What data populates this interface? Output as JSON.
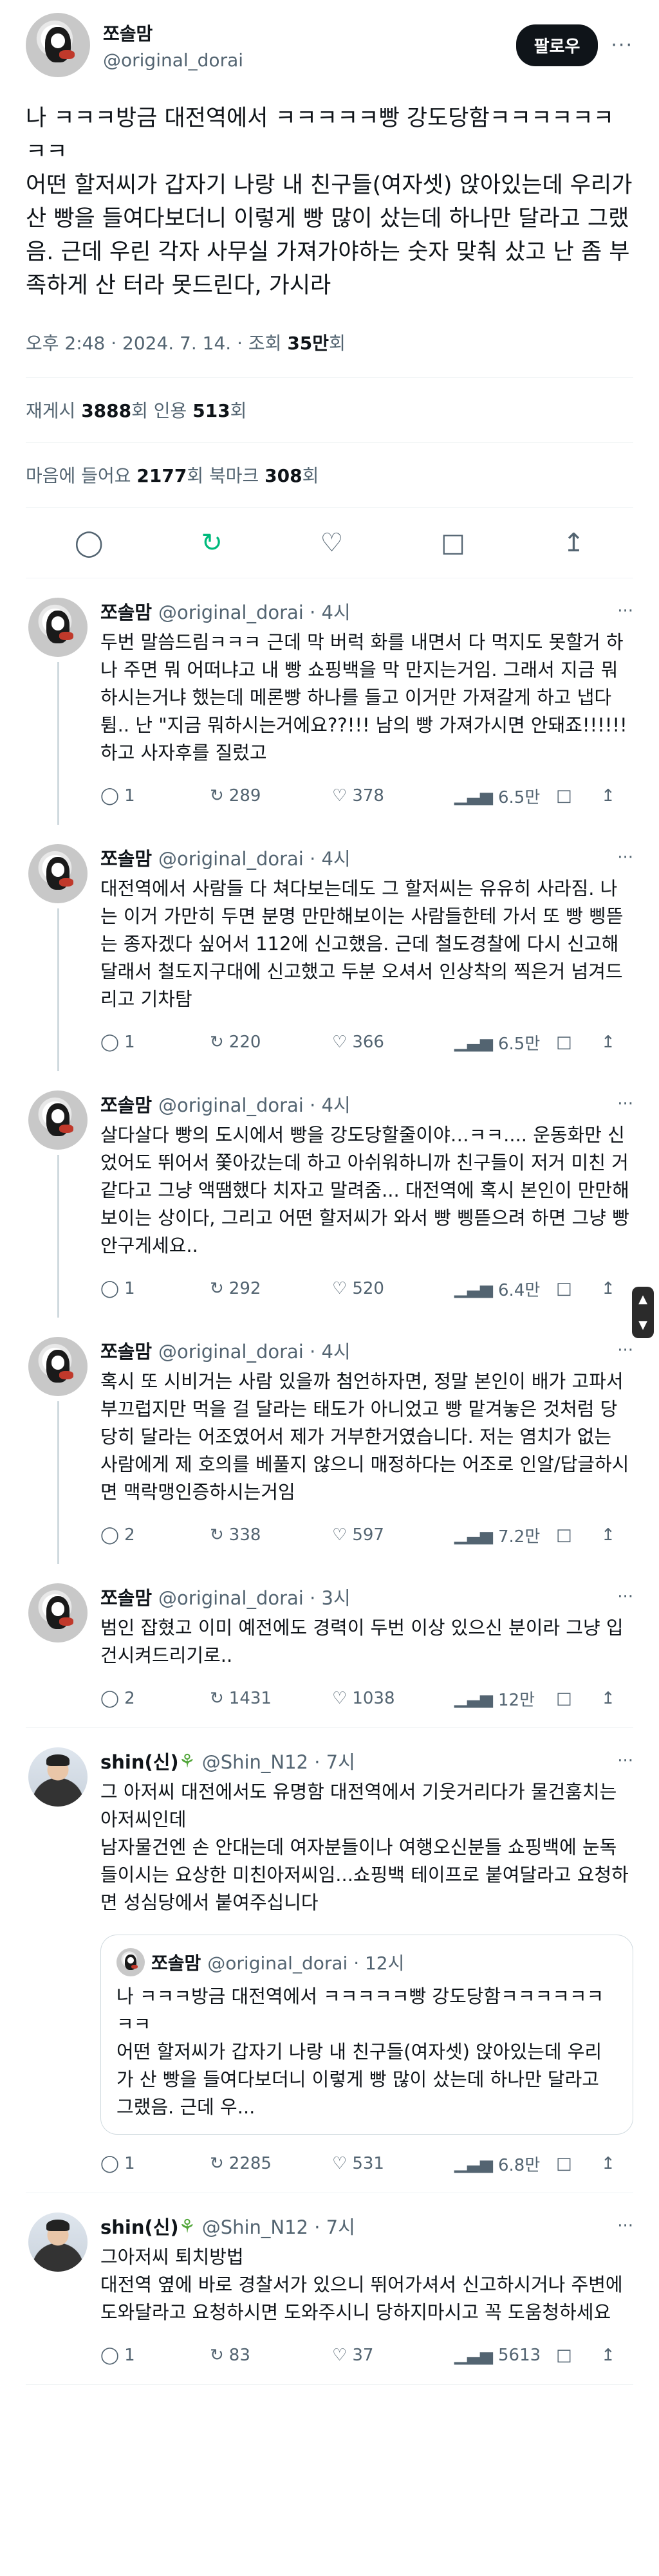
{
  "tweet": {
    "author_name": "쪼솔맘",
    "author_handle": "@original_dorai",
    "follow_label": "팔로우",
    "more": "···",
    "text": "나 ㅋㅋㅋ방금 대전역에서 ㅋㅋㅋㅋㅋ빵 강도당함ㅋㅋㅋㅋㅋㅋㅋㅋ\n어떤 할저씨가 갑자기 나랑 내 친구들(여자셋) 앉아있는데 우리가 산 빵을 들여다보더니 이렇게 빵 많이 샀는데 하나만 달라고 그랬음. 근데 우린 각자 사무실 가져가야하는 숫자 맞춰 샀고 난 좀 부족하게 산 터라 못드린다, 가시라",
    "time": "오후 2:48 · 2024. 7. 14. · 조회 ",
    "views": "35만",
    "views_suffix": "회",
    "retweets_label": "재게시 ",
    "retweets": "3888",
    "retweets_suffix": "회  인용 ",
    "quotes": "513",
    "quotes_suffix": "회",
    "likes_label": "마음에 들어요 ",
    "likes": "2177",
    "likes_suffix": "회  북마크 ",
    "bookmarks": "308",
    "bookmarks_suffix": "회"
  },
  "replies": [
    {
      "name": "쪼솔맘",
      "handle": "@original_dorai · 4시",
      "text": "두번 말씀드림ㅋㅋㅋ 근데 막 버럭 화를 내면서 다 먹지도 못할거 하나 주면 뭐 어떠냐고 내 빵 쇼핑백을 막 만지는거임. 그래서 지금 뭐하시는거냐 했는데 메론빵 하나를 들고 이거만 가져갈게 하고 냅다 튐.. 난 \"지금 뭐하시는거에요??!!! 남의 빵 가져가시면 안돼죠!!!!!!하고 사자후를 질렀고",
      "reply": "1",
      "rt": "289",
      "like": "378",
      "views": "6.5만"
    },
    {
      "name": "쪼솔맘",
      "handle": "@original_dorai · 4시",
      "text": "대전역에서 사람들 다 쳐다보는데도 그 할저씨는 유유히 사라짐. 나는 이거 가만히 두면 분명 만만해보이는 사람들한테 가서 또 빵 삥뜯는 종자겠다 싶어서 112에 신고했음. 근데 철도경찰에 다시 신고해달래서 철도지구대에 신고했고 두분 오셔서 인상착의 찍은거 넘겨드리고 기차탐",
      "reply": "1",
      "rt": "220",
      "like": "366",
      "views": "6.5만"
    },
    {
      "name": "쪼솔맘",
      "handle": "@original_dorai · 4시",
      "text": "살다살다 빵의 도시에서 빵을 강도당할줄이야…ㅋㅋ.... 운동화만 신었어도 뛰어서 쫓아갔는데 하고 아쉬워하니까 친구들이 저거 미친 거 같다고 그냥 액땜했다 치자고 말려줌... 대전역에 혹시 본인이 만만해보이는 상이다, 그리고 어떤 할저씨가 와서 빵 삥뜯으려 하면 그냥 빵 안구게세요..",
      "reply": "1",
      "rt": "292",
      "like": "520",
      "views": "6.4만"
    },
    {
      "name": "쪼솔맘",
      "handle": "@original_dorai · 4시",
      "text": "혹시 또 시비거는 사람 있을까 첨언하자면, 정말 본인이 배가 고파서 부끄럽지만 먹을 걸 달라는 태도가 아니었고 빵 맡겨놓은 것처럼 당당히 달라는 어조였어서 제가 거부한거였습니다. 저는 염치가 없는 사람에게 제 호의를 베풀지 않으니 매정하다는 어조로 인알/답글하시면 맥락맹인증하시는거임",
      "reply": "2",
      "rt": "338",
      "like": "597",
      "views": "7.2만"
    },
    {
      "name": "쪼솔맘",
      "handle": "@original_dorai · 3시",
      "text": "범인 잡혔고 이미 예전에도 경력이 두번 이상 있으신 분이라 그냥 입건시켜드리기로..",
      "reply": "2",
      "rt": "1431",
      "like": "1038",
      "views": "12만"
    }
  ],
  "other_replies": [
    {
      "name": "shin(신)",
      "handle": "@Shin_N12 · 7시",
      "text": "그 아저씨 대전에서도 유명함 대전역에서 기웃거리다가 물건훔치는 아저씨인데\n남자물건엔 손 안대는데 여자분들이나 여행오신분들 쇼핑백에 눈독들이시는 요상한 미친아저씨임...쇼핑백 테이프로 붙여달라고 요청하면 성심당에서 붙여주십니다",
      "quote_name": "쪼솔맘",
      "quote_handle": "@original_dorai · 12시",
      "quote_text": "나 ㅋㅋㅋ방금 대전역에서 ㅋㅋㅋㅋㅋ빵 강도당함ㅋㅋㅋㅋㅋㅋㅋㅋ\n어떤 할저씨가 갑자기 나랑 내 친구들(여자셋) 앉아있는데 우리가 산 빵을 들여다보더니 이렇게 빵 많이 샀는데 하나만 달라고 그랬음. 근데 우...",
      "reply": "1",
      "rt": "2285",
      "like": "531",
      "views": "6.8만"
    },
    {
      "name": "shin(신)",
      "handle": "@Shin_N12 · 7시",
      "text": "그아저씨 퇴치방법\n대전역 옆에 바로 경찰서가 있으니 뛰어가셔서 신고하시거나 주변에 도와달라고 요청하시면 도와주시니 당하지마시고 꼭 도움청하세요",
      "reply": "1",
      "rt": "83",
      "like": "37",
      "views": "5613"
    }
  ]
}
